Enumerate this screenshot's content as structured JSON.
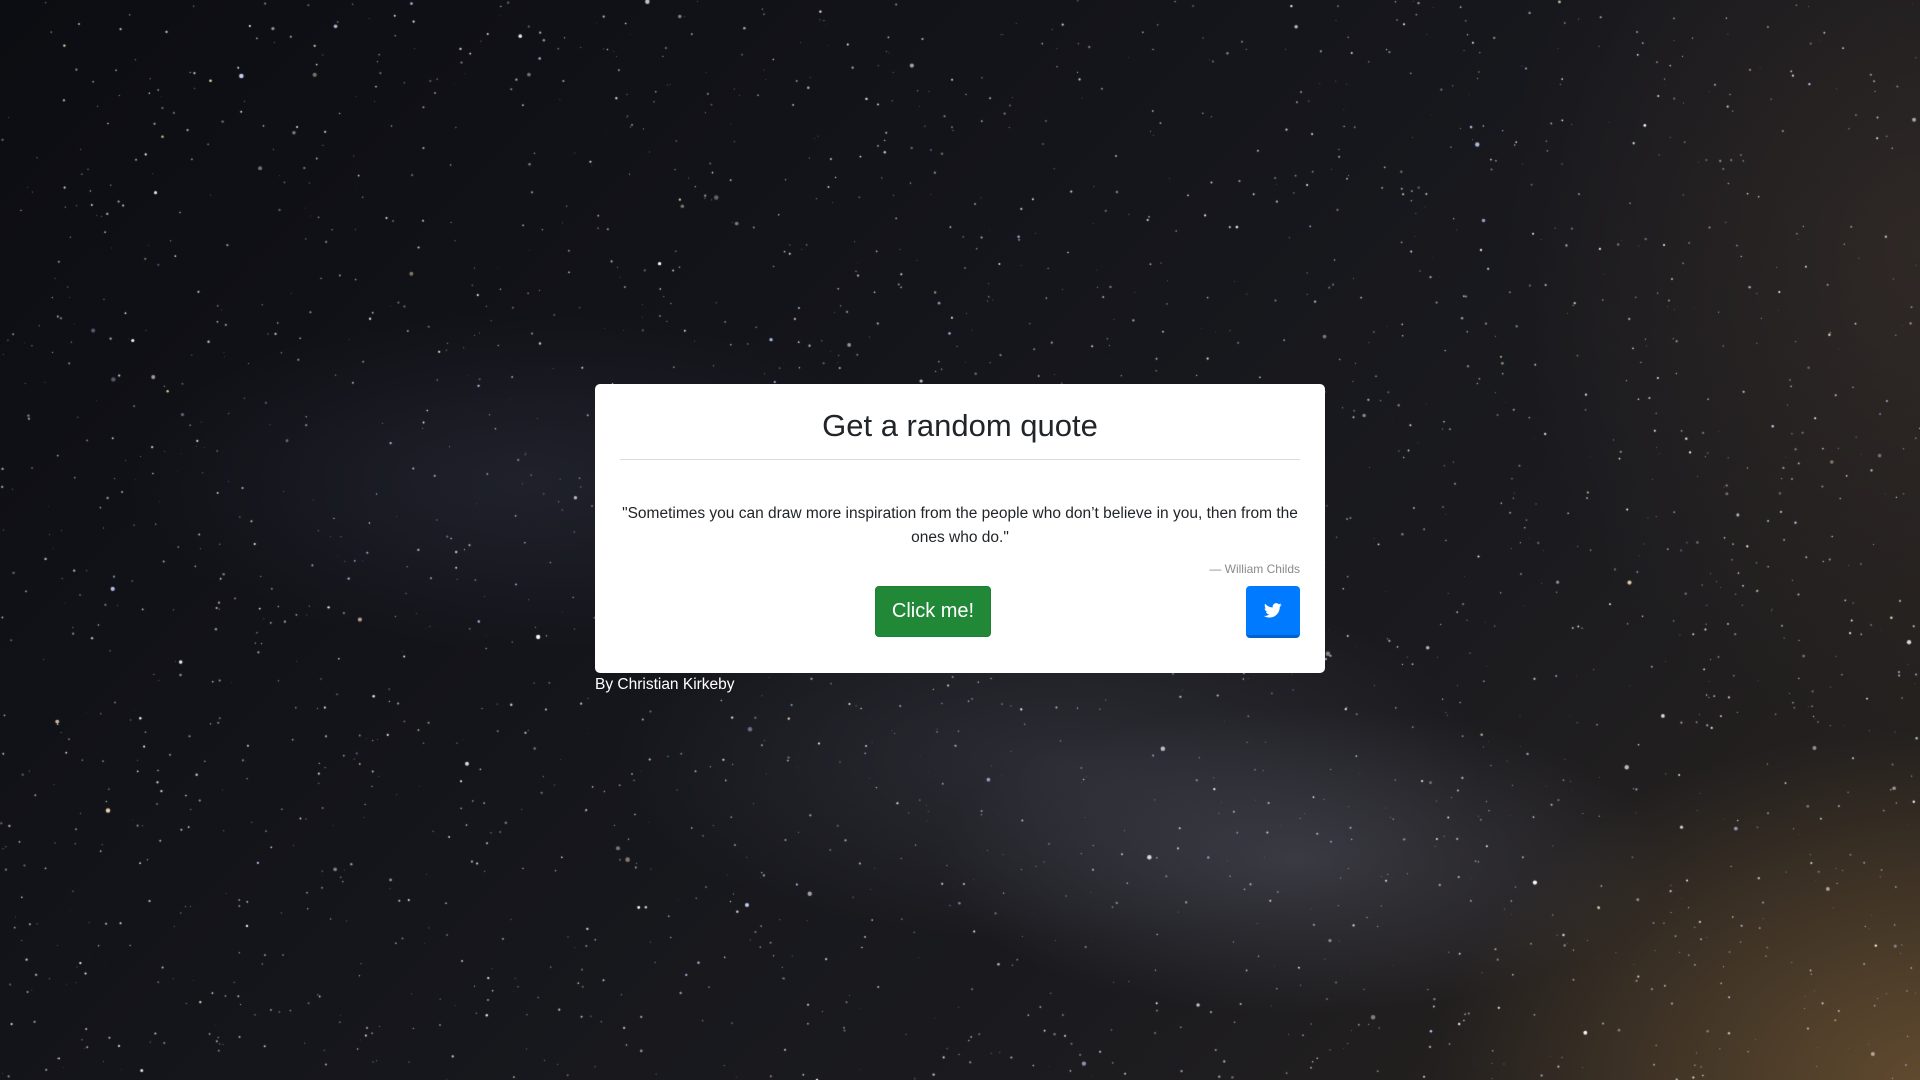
{
  "card": {
    "title": "Get a random quote",
    "quote": "\"Sometimes you can draw more inspiration from the people who don’t believe in you, then from the ones who do.\"",
    "author": "— William Childs",
    "new_quote_label": "Click me!",
    "tweet_icon": "twitter-icon"
  },
  "footer": {
    "credit": "By Christian Kirkeby"
  },
  "colors": {
    "new_quote_button": "#218838",
    "tweet_button": "#007bff",
    "card_background": "#ffffff"
  },
  "background": {
    "description_icon": "starry-sky-background"
  }
}
